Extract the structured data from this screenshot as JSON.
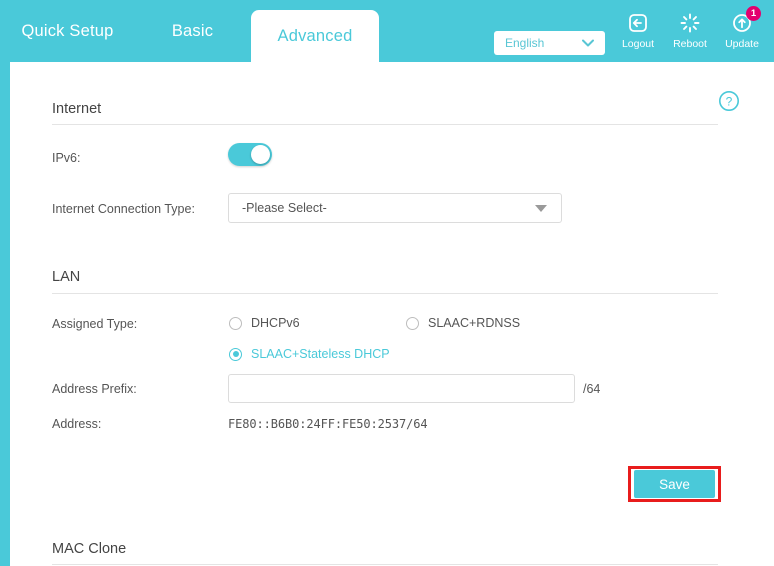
{
  "header": {
    "tabs": [
      {
        "label": "Quick Setup",
        "active": false
      },
      {
        "label": "Basic",
        "active": false
      },
      {
        "label": "Advanced",
        "active": true
      }
    ],
    "language": {
      "value": "English",
      "icon": "chevron-down-icon"
    },
    "actions": [
      {
        "label": "Logout",
        "icon": "logout-icon"
      },
      {
        "label": "Reboot",
        "icon": "reboot-icon"
      },
      {
        "label": "Update",
        "icon": "update-icon",
        "badge": "1"
      }
    ],
    "accent_color": "#4ac9d9",
    "badge_color": "#e3006e"
  },
  "main": {
    "help_icon": "help-circle-icon",
    "internet": {
      "title": "Internet",
      "ipv6": {
        "label": "IPv6:",
        "enabled": true
      },
      "connection_type": {
        "label": "Internet Connection Type:",
        "value": "-Please Select-"
      }
    },
    "lan": {
      "title": "LAN",
      "assigned_type": {
        "label": "Assigned Type:",
        "options": [
          {
            "label": "DHCPv6",
            "selected": false
          },
          {
            "label": "SLAAC+RDNSS",
            "selected": false
          },
          {
            "label": "SLAAC+Stateless DHCP",
            "selected": true
          }
        ]
      },
      "address_prefix": {
        "label": "Address Prefix:",
        "value": "",
        "placeholder": "",
        "suffix": "/64"
      },
      "address": {
        "label": "Address:",
        "value": "FE80::B6B0:24FF:FE50:2537/64"
      }
    },
    "save_button": {
      "label": "Save",
      "highlight_color": "#e81c1c"
    },
    "mac_clone": {
      "title": "MAC Clone"
    }
  }
}
